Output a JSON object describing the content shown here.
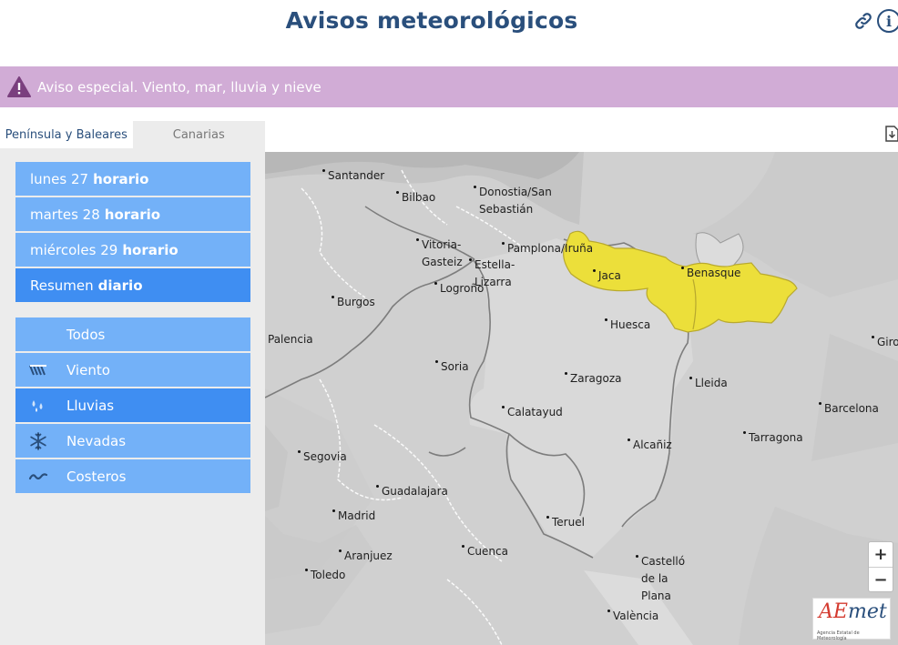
{
  "header": {
    "title": "Avisos meteorológicos"
  },
  "alert": {
    "text": "Aviso especial. Viento, mar, lluvia y nieve"
  },
  "tabs": [
    {
      "label": "Península y Baleares"
    },
    {
      "label": "Canarias"
    }
  ],
  "days": [
    {
      "day": "lunes 27",
      "mode": "horario"
    },
    {
      "day": "martes 28",
      "mode": "horario"
    },
    {
      "day": "miércoles 29",
      "mode": "horario"
    },
    {
      "day": "Resumen",
      "mode": "diario"
    }
  ],
  "types": [
    {
      "label": "Todos"
    },
    {
      "label": "Viento"
    },
    {
      "label": "Lluvias"
    },
    {
      "label": "Nevadas"
    },
    {
      "label": "Costeros"
    }
  ],
  "map": {
    "cities": {
      "santander": "Santander",
      "bilbao": "Bilbao",
      "donostia1": "Donostia/San",
      "donostia2": "Sebastián",
      "vitoria1": "Vitoria-",
      "vitoria2": "Gasteiz",
      "pamplona": "Pamplona/Iruña",
      "estella1": "Estella-",
      "estella2": "Lizarra",
      "logrono": "Logroño",
      "jaca": "Jaca",
      "benasque": "Benasque",
      "burgos": "Burgos",
      "huesca": "Huesca",
      "palencia": "Palencia",
      "girona": "Giro",
      "soria": "Soria",
      "zaragoza": "Zaragoza",
      "lleida": "Lleida",
      "barcelona": "Barcelona",
      "calatayud": "Calatayud",
      "tarragona": "Tarragona",
      "alcaniz": "Alcañiz",
      "segovia": "Segovia",
      "guadalajara": "Guadalajara",
      "madrid": "Madrid",
      "teruel": "Teruel",
      "aranjuez": "Aranjuez",
      "cuenca": "Cuenca",
      "castello1": "Castelló",
      "castello2": "de la",
      "castello3": "Plana",
      "toledo": "Toledo",
      "valencia": "València"
    },
    "zoom_in": "+",
    "zoom_out": "−",
    "warning_color": "#ecdf3a"
  },
  "logo": {
    "brand_a": "AE",
    "brand_b": "met",
    "subtitle": "Agencia Estatal de Meteorología"
  },
  "colors": {
    "accent": "#2a4f7c",
    "menu": "#73b1f8",
    "menu_selected": "#3f8ef2",
    "alert_bg": "#d1acd6"
  }
}
